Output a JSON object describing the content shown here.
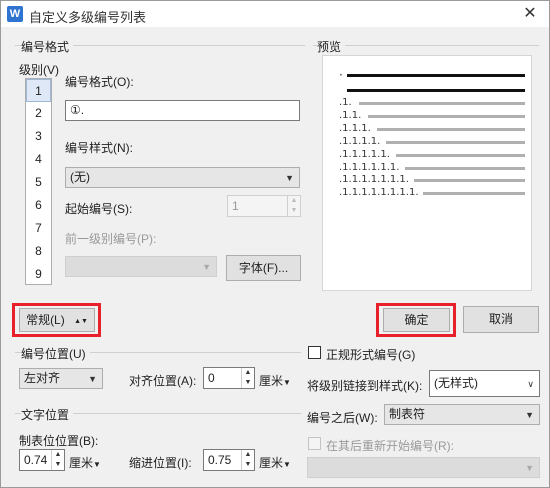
{
  "window": {
    "title": "自定义多级编号列表",
    "app_icon_letter": "W",
    "close_glyph": "✕"
  },
  "number_format_group": {
    "label": "编号格式",
    "level_label": "级别(V)",
    "levels": [
      "1",
      "2",
      "3",
      "4",
      "5",
      "6",
      "7",
      "8",
      "9"
    ],
    "selected_level": "1",
    "format_label": "编号格式(O):",
    "format_value": "①.",
    "style_label": "编号样式(N):",
    "style_value": "(无)",
    "start_label": "起始编号(S):",
    "start_value": "1",
    "prev_level_label": "前一级别编号(P):",
    "prev_level_value": "",
    "font_button": "字体(F)..."
  },
  "preview": {
    "label": "预览",
    "rows": [
      ".1.",
      ".1.1.",
      ".1.1.1.",
      ".1.1.1.1.",
      ".1.1.1.1.1.",
      ".1.1.1.1.1.1.",
      ".1.1.1.1.1.1.1.",
      ".1.1.1.1.1.1.1.1."
    ]
  },
  "buttons": {
    "normal": "常规(L)",
    "normal_arrow": "▲▼",
    "ok": "确定",
    "cancel": "取消"
  },
  "number_position": {
    "label": "编号位置(U)",
    "align_value": "左对齐",
    "align_pos_label": "对齐位置(A):",
    "align_pos_value": "0",
    "unit": "厘米"
  },
  "text_position": {
    "label": "文字位置",
    "tab_pos_label": "制表位位置(B):",
    "tab_pos_value": "0.74",
    "indent_label": "缩进位置(I):",
    "indent_value": "0.75",
    "unit": "厘米"
  },
  "options": {
    "legal_label": "正规形式编号(G)",
    "link_label": "将级别链接到样式(K):",
    "link_value": "(无样式)",
    "after_label": "编号之后(W):",
    "after_value": "制表符",
    "restart_label": "在其后重新开始编号(R):",
    "restart_value": ""
  }
}
